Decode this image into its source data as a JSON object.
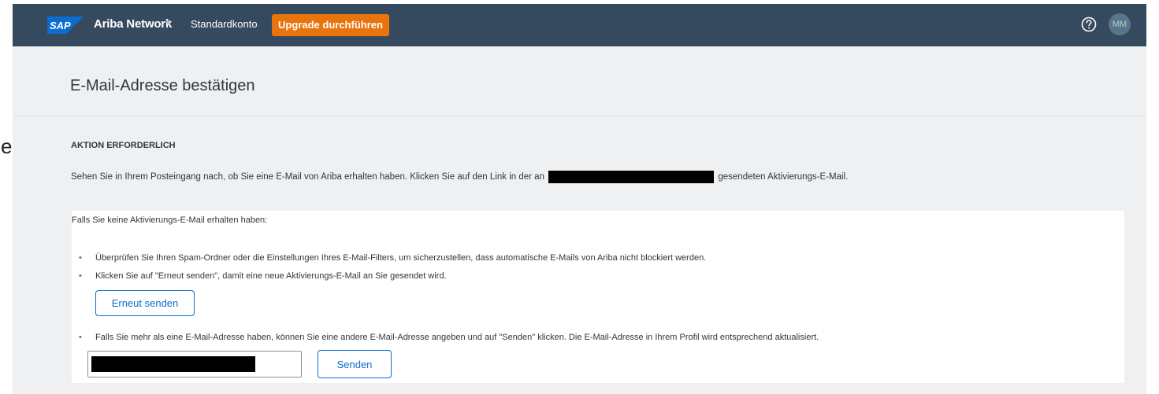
{
  "stray_char": "e",
  "shellbar": {
    "logo_text": "SAP",
    "product": "Ariba Network",
    "product_chevron": "chevron-down-icon",
    "account_type": "Standardkonto",
    "upgrade_label": "Upgrade durchführen",
    "help_icon": "help-circle-icon",
    "avatar_initials": "MM",
    "colors": {
      "shellbar": "#354a5f",
      "upgrade": "#e9730c",
      "sap_logo": "#0a6ed1"
    }
  },
  "page": {
    "title": "E-Mail-Adresse bestätigen",
    "action_heading": "AKTION ERFORDERLICH",
    "instruction_before": "Sehen Sie in Ihrem Posteingang nach, ob Sie eine E-Mail von Ariba erhalten haben. Klicken Sie auf den Link in der an",
    "instruction_after": "gesendeten Aktivierungs-E-Mail."
  },
  "panel": {
    "intro": "Falls Sie keine Aktivierungs-E-Mail erhalten haben:",
    "bullets": [
      "Überprüfen Sie Ihren Spam-Ordner oder die Einstellungen Ihres E-Mail-Filters, um sicherzustellen, dass automatische E-Mails von Ariba nicht blockiert werden.",
      "Klicken Sie auf \"Erneut senden\", damit eine neue Aktivierungs-E-Mail an Sie gesendet wird.",
      "Falls Sie mehr als eine E-Mail-Adresse haben, können Sie eine andere E-Mail-Adresse angeben und auf \"Senden\" klicken. Die E-Mail-Adresse in Ihrem Profil wird entsprechend aktualisiert."
    ],
    "resend_label": "Erneut senden",
    "send_label": "Senden",
    "accent": "#0a6ed1"
  }
}
